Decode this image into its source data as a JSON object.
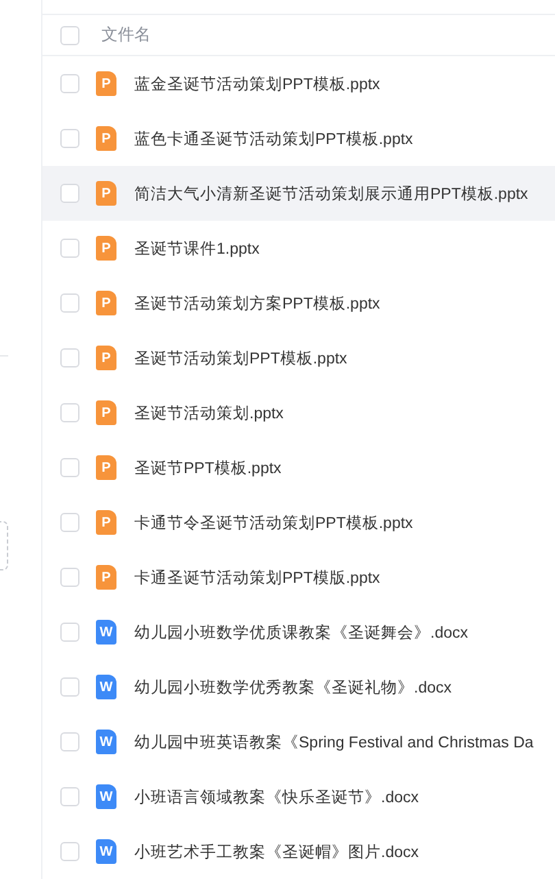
{
  "header": {
    "label": "文件名",
    "checked": false
  },
  "files": [
    {
      "name": "蓝金圣诞节活动策划PPT模板.pptx",
      "kind": "ppt",
      "icon_letter": "P",
      "checked": false,
      "hovered": false
    },
    {
      "name": "蓝色卡通圣诞节活动策划PPT模板.pptx",
      "kind": "ppt",
      "icon_letter": "P",
      "checked": false,
      "hovered": false
    },
    {
      "name": "简洁大气小清新圣诞节活动策划展示通用PPT模板.pptx",
      "kind": "ppt",
      "icon_letter": "P",
      "checked": false,
      "hovered": true
    },
    {
      "name": "圣诞节课件1.pptx",
      "kind": "ppt",
      "icon_letter": "P",
      "checked": false,
      "hovered": false
    },
    {
      "name": "圣诞节活动策划方案PPT模板.pptx",
      "kind": "ppt",
      "icon_letter": "P",
      "checked": false,
      "hovered": false
    },
    {
      "name": "圣诞节活动策划PPT模板.pptx",
      "kind": "ppt",
      "icon_letter": "P",
      "checked": false,
      "hovered": false
    },
    {
      "name": "圣诞节活动策划.pptx",
      "kind": "ppt",
      "icon_letter": "P",
      "checked": false,
      "hovered": false
    },
    {
      "name": "圣诞节PPT模板.pptx",
      "kind": "ppt",
      "icon_letter": "P",
      "checked": false,
      "hovered": false
    },
    {
      "name": "卡通节令圣诞节活动策划PPT模板.pptx",
      "kind": "ppt",
      "icon_letter": "P",
      "checked": false,
      "hovered": false
    },
    {
      "name": "卡通圣诞节活动策划PPT模版.pptx",
      "kind": "ppt",
      "icon_letter": "P",
      "checked": false,
      "hovered": false
    },
    {
      "name": "幼儿园小班数学优质课教案《圣诞舞会》.docx",
      "kind": "doc",
      "icon_letter": "W",
      "checked": false,
      "hovered": false
    },
    {
      "name": "幼儿园小班数学优秀教案《圣诞礼物》.docx",
      "kind": "doc",
      "icon_letter": "W",
      "checked": false,
      "hovered": false
    },
    {
      "name": "幼儿园中班英语教案《Spring Festival and Christmas Da",
      "kind": "doc",
      "icon_letter": "W",
      "checked": false,
      "hovered": false
    },
    {
      "name": "小班语言领域教案《快乐圣诞节》.docx",
      "kind": "doc",
      "icon_letter": "W",
      "checked": false,
      "hovered": false
    },
    {
      "name": "小班艺术手工教案《圣诞帽》图片.docx",
      "kind": "doc",
      "icon_letter": "W",
      "checked": false,
      "hovered": false
    }
  ]
}
